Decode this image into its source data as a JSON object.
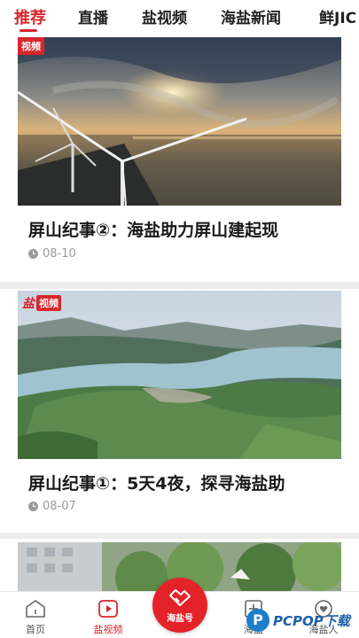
{
  "tabs": [
    {
      "label": "推荐",
      "active": true
    },
    {
      "label": "直播",
      "active": false
    },
    {
      "label": "盐视频",
      "active": false
    },
    {
      "label": "海盐新闻",
      "active": false
    },
    {
      "label": "鲜JIC",
      "active": false
    }
  ],
  "cards": [
    {
      "badge": "视频",
      "title": "屏山纪事②：海盐助力屏山建起现",
      "date": "08-10"
    },
    {
      "badge_brand": "盐",
      "badge": "视频",
      "title": "屏山纪事①：5天4夜，探寻海盐助",
      "date": "08-07"
    }
  ],
  "bottom_nav": {
    "items": [
      {
        "label": "首页",
        "icon": "home-icon"
      },
      {
        "label": "盐视频",
        "icon": "play-icon",
        "active": true
      },
      {
        "label": "海盐号",
        "icon": "handshake-icon",
        "center": true
      },
      {
        "label": "海盐",
        "icon": "plus-icon"
      },
      {
        "label": "海盐人",
        "icon": "heart-icon"
      }
    ]
  },
  "watermark": {
    "logo_text": "P",
    "text": "PCPOP下载"
  },
  "colors": {
    "accent": "#d8262c"
  }
}
